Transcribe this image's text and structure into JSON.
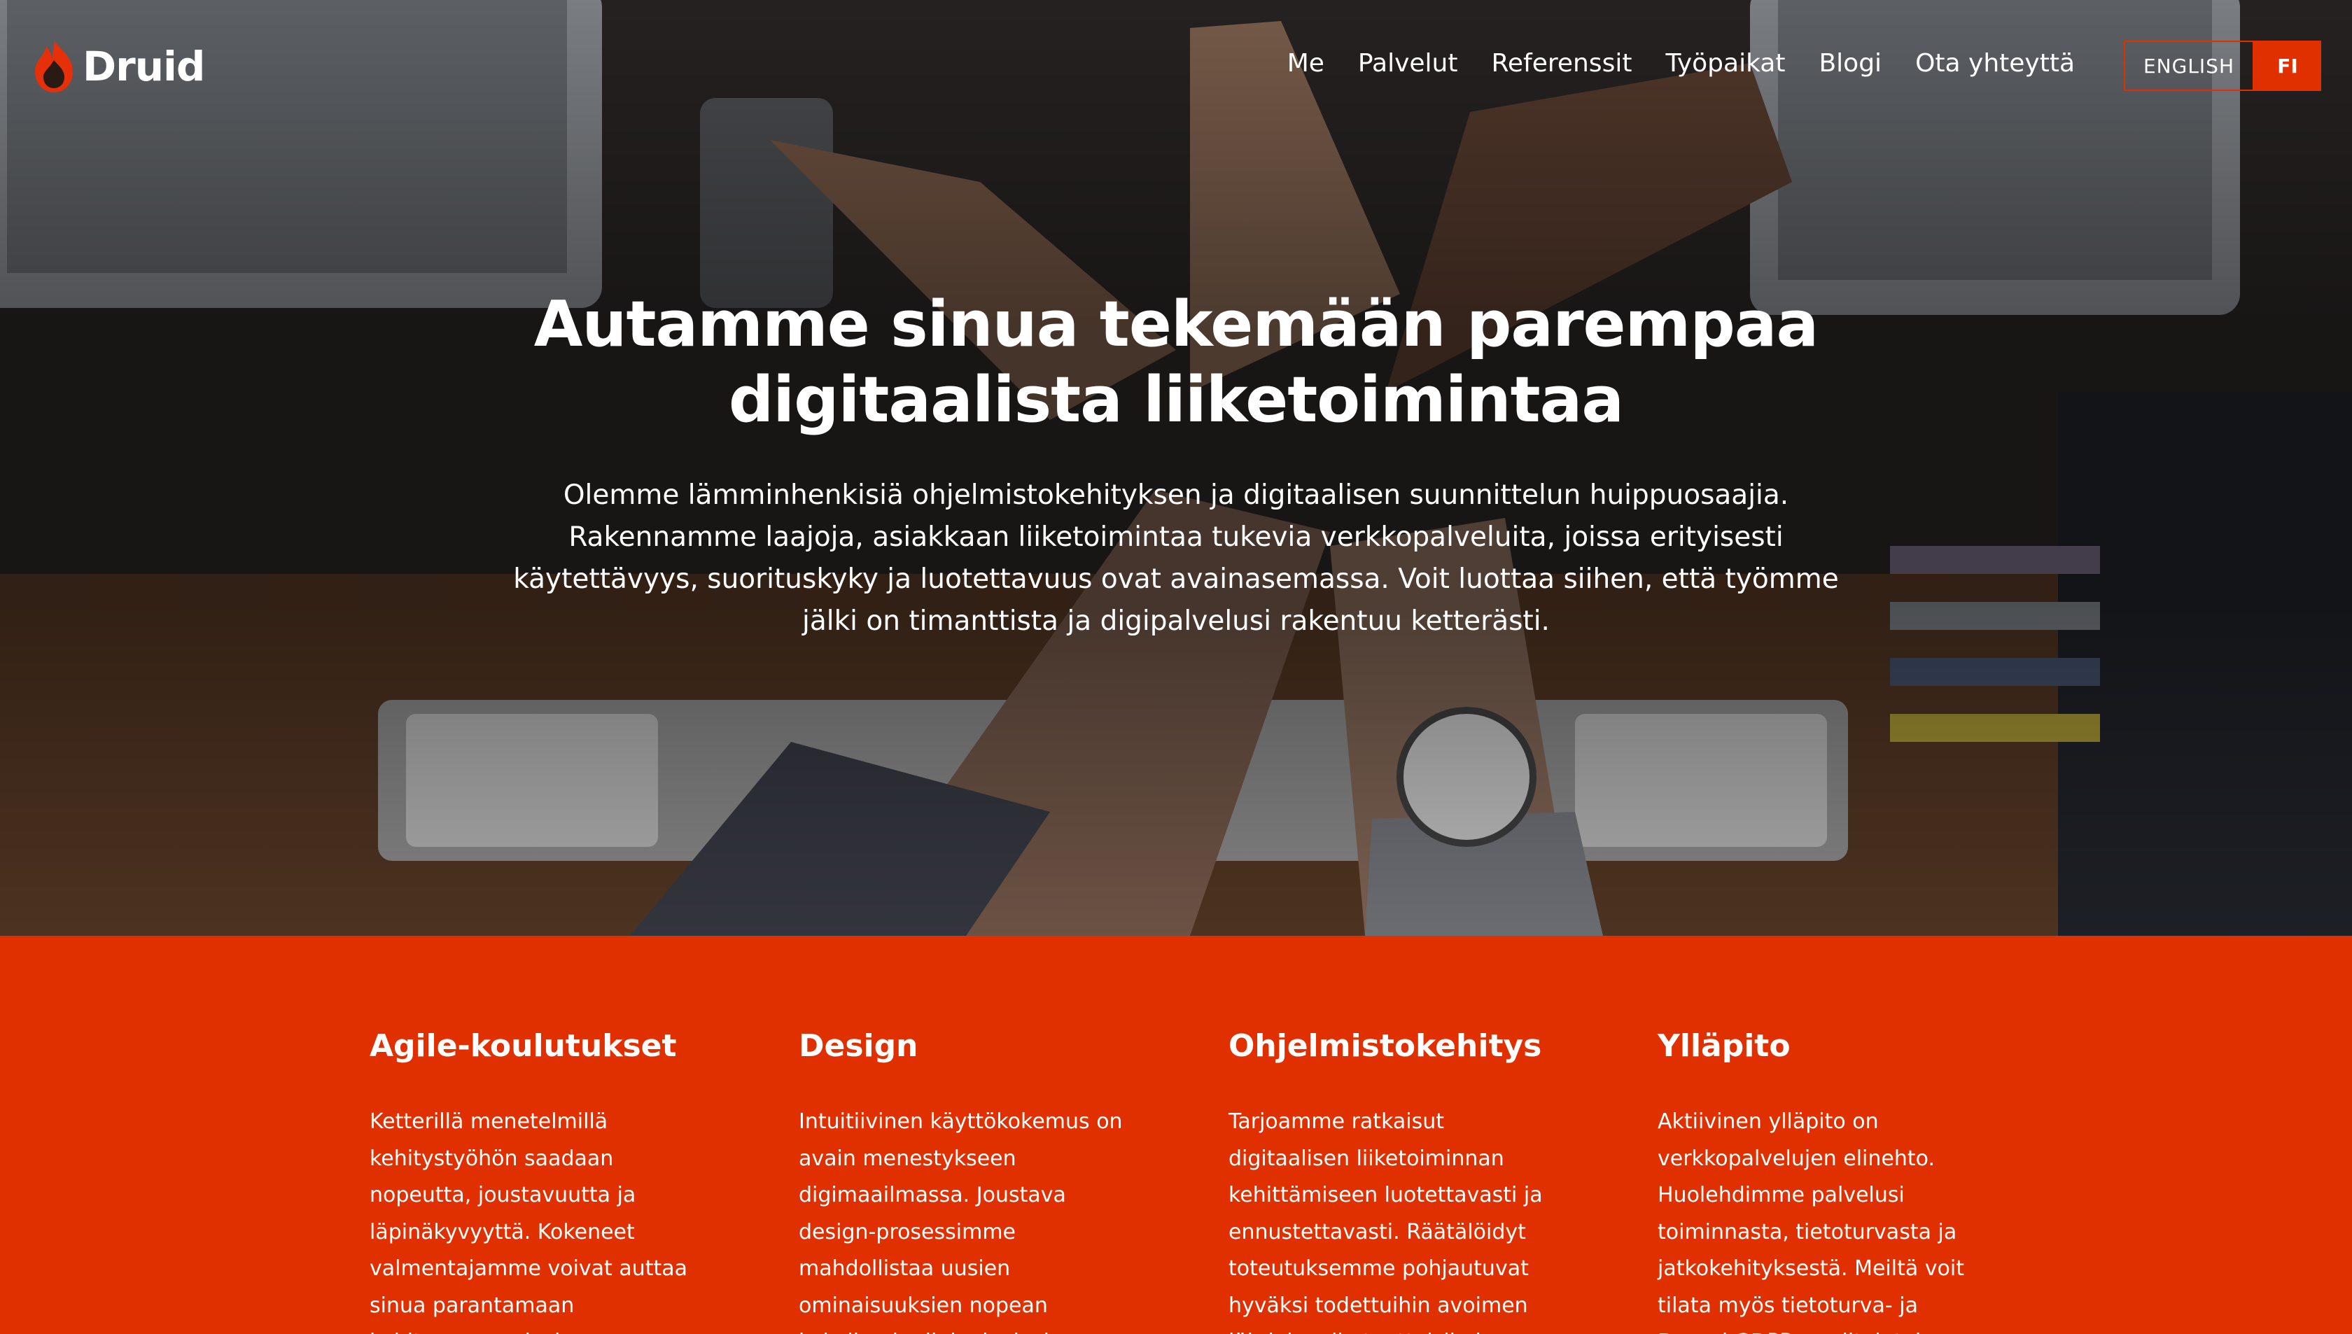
{
  "brand": {
    "name": "Druid",
    "accent_color": "#e03000"
  },
  "nav": {
    "items": [
      {
        "label": "Me"
      },
      {
        "label": "Palvelut"
      },
      {
        "label": "Referenssit"
      },
      {
        "label": "Työpaikat"
      },
      {
        "label": "Blogi"
      },
      {
        "label": "Ota yhteyttä"
      }
    ]
  },
  "language": {
    "english": "ENGLISH",
    "finnish": "FI",
    "selected": "FI"
  },
  "hero": {
    "title_line1": "Autamme sinua tekemään parempaa",
    "title_line2": "digitaalista liiketoimintaa",
    "text": "Olemme lämminhenkisiä ohjelmistokehityksen ja digitaalisen suunnittelun huippuosaajia. Rakennamme laajoja, asiakkaan liiketoimintaa tukevia verkkopalveluita, joissa erityisesti käytettävyys, suorituskyky ja luotettavuus ovat avainasemassa. Voit luottaa siihen, että työmme jälki on timanttista ja digipalvelusi rakentuu ketterästi."
  },
  "services": [
    {
      "title": "Agile-koulutukset",
      "text": "Ketterillä menetelmillä kehitystyöhön saadaan nopeutta, joustavuutta ja läpinäkyvyyttä. Kokeneet valmentajamme voivat auttaa sinua parantamaan kehitysprosessiasi."
    },
    {
      "title": "Design",
      "text": "Intuitiivinen käyttökokemus on avain menestykseen digimaailmassa. Joustava design-prosessimme mahdollistaa uusien ominaisuuksien nopean kokeilun ja digipalvelusi"
    },
    {
      "title": "Ohjelmistokehitys",
      "text": "Tarjoamme ratkaisut digitaalisen liiketoiminnan kehittämiseen luotettavasti ja ennustettavasti. Räätälöidyt toteutuksemme pohjautuvat hyväksi todettuihin avoimen lähdekoodin tuotteisiin ja"
    },
    {
      "title": "Ylläpito",
      "text": "Aktiivinen ylläpito on verkkopalvelujen elinehto. Huolehdimme palvelusi toiminnasta, tietoturvasta ja jatkokehityksestä. Meiltä voit tilata myös tietoturva- ja Drupal GDPR -auditointeja."
    }
  ]
}
